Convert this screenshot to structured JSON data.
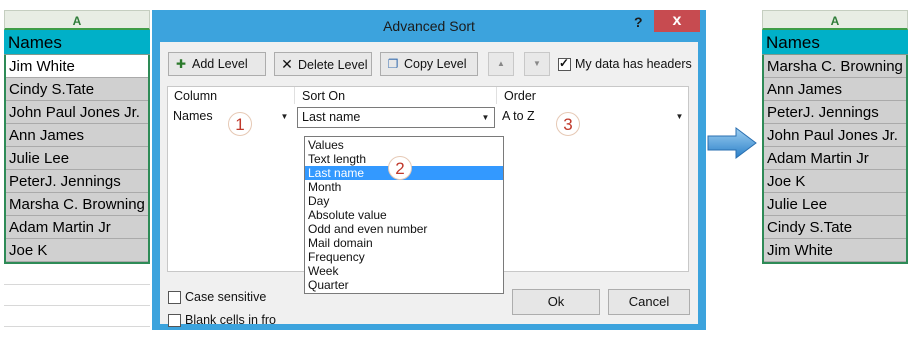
{
  "left_sheet": {
    "column": "A",
    "header": "Names",
    "rows": [
      "Jim White",
      "Cindy S.Tate",
      "John Paul Jones Jr.",
      "Ann James",
      "Julie Lee",
      "PeterJ. Jennings",
      "Marsha C. Browning",
      "Adam Martin Jr",
      "Joe K"
    ]
  },
  "right_sheet": {
    "column": "A",
    "header": "Names",
    "rows": [
      "Marsha C. Browning",
      "Ann James",
      "PeterJ. Jennings",
      "John Paul Jones Jr.",
      "Adam Martin Jr",
      "Joe K",
      "Julie Lee",
      "Cindy S.Tate",
      "Jim White"
    ]
  },
  "dialog": {
    "title": "Advanced Sort",
    "help": "?",
    "close": "x",
    "toolbar": {
      "add_level": "Add Level",
      "delete_level": "Delete Level",
      "copy_level": "Copy Level",
      "up": "▲",
      "down": "▼",
      "headers_label": "My data has headers",
      "headers_checked": true
    },
    "grid": {
      "col_column": "Column",
      "col_sort_on": "Sort On",
      "col_order": "Order",
      "column_value": "Names",
      "sort_on_value": "Last name",
      "order_value": "A to Z"
    },
    "sort_on_options": [
      "Values",
      "Text length",
      "Last name",
      "Month",
      "Day",
      "Absolute value",
      "Odd and even number",
      "Mail domain",
      "Frequency",
      "Week",
      "Quarter"
    ],
    "selected_option": "Last name",
    "case_sensitive_label": "Case sensitive",
    "blank_cells_label": "Blank cells in fro",
    "ok": "Ok",
    "cancel": "Cancel"
  },
  "markers": [
    "1",
    "2",
    "3"
  ],
  "colors": {
    "accent": "#3ca3dd",
    "header_fill": "#00b0c8",
    "selection": "#3399ff",
    "marker": "#c0392b"
  }
}
